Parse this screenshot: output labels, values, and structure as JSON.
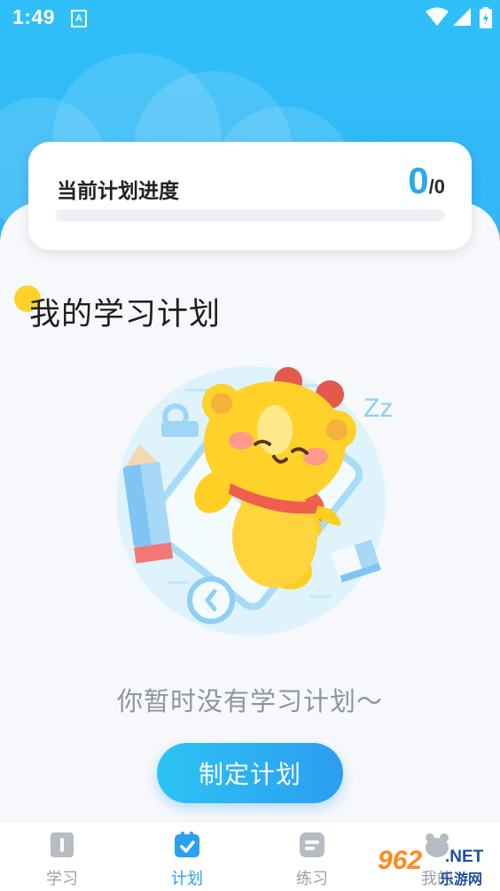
{
  "status_bar": {
    "time": "1:49",
    "notification_badge": "A"
  },
  "progress": {
    "label": "当前计划进度",
    "done": "0",
    "total": "0",
    "separator": "/",
    "fraction": 0
  },
  "section": {
    "title": "我的学习计划"
  },
  "illustration": {
    "sleep_text": "Zz"
  },
  "empty_state": {
    "text": "你暂时没有学习计划～",
    "button_label": "制定计划"
  },
  "nav": {
    "items": [
      {
        "label": "学习",
        "icon": "book-icon",
        "active": false
      },
      {
        "label": "计划",
        "icon": "calendar-check-icon",
        "active": true
      },
      {
        "label": "练习",
        "icon": "exercise-icon",
        "active": false
      },
      {
        "label": "我的",
        "icon": "profile-icon",
        "active": false
      }
    ]
  },
  "watermark": {
    "number": "962",
    "domain": ".NET",
    "site_name": "乐游网"
  },
  "colors": {
    "accent": "#2aa7ee",
    "header": "#31bbf8",
    "dot": "#ffd22a",
    "text_muted": "#8f959c"
  }
}
